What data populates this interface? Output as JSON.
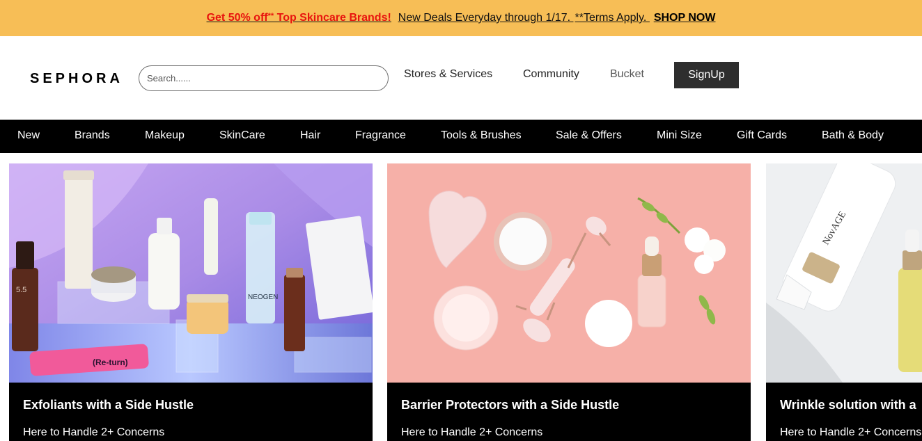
{
  "promo": {
    "highlight": "Get 50% off",
    "stars": "**",
    "brands": " Top Skincare Brands!",
    "deals": "New Deals Everyday through 1/17.",
    "terms": "**Terms Apply.",
    "cta": "SHOP NOW",
    "colors": {
      "background": "#f7be56",
      "highlight": "#e8140e"
    }
  },
  "header": {
    "logo": "SEPHORA",
    "search": {
      "placeholder": "Search......",
      "value": ""
    },
    "links": [
      "Stores & Services",
      "Community",
      "Bucket"
    ],
    "signup_label": "SignUp"
  },
  "nav": {
    "items": [
      "New",
      "Brands",
      "Makeup",
      "SkinCare",
      "Hair",
      "Fragrance",
      "Tools & Brushes",
      "Sale & Offers",
      "Mini Size",
      "Gift Cards",
      "Bath & Body"
    ]
  },
  "cards": [
    {
      "title": "Exfoliants with a Side Hustle",
      "subtitle": "Here to Handle 2+ Concerns",
      "image": "skincare-products-photo"
    },
    {
      "title": "Barrier Protectors with a Side Hustle",
      "subtitle": "Here to Handle 2+ Concerns",
      "image": "face-roller-and-creams-photo"
    },
    {
      "title": "Wrinkle solution with a",
      "subtitle": "Here to Handle 2+ Concerns",
      "image": "cleansing-bottles-photo"
    }
  ],
  "product_labels": {
    "serum": "5.5",
    "tube": "(Re-turn)",
    "bottle_brand": "NEOGEN",
    "bottle_brand_2": "NovAGE"
  }
}
